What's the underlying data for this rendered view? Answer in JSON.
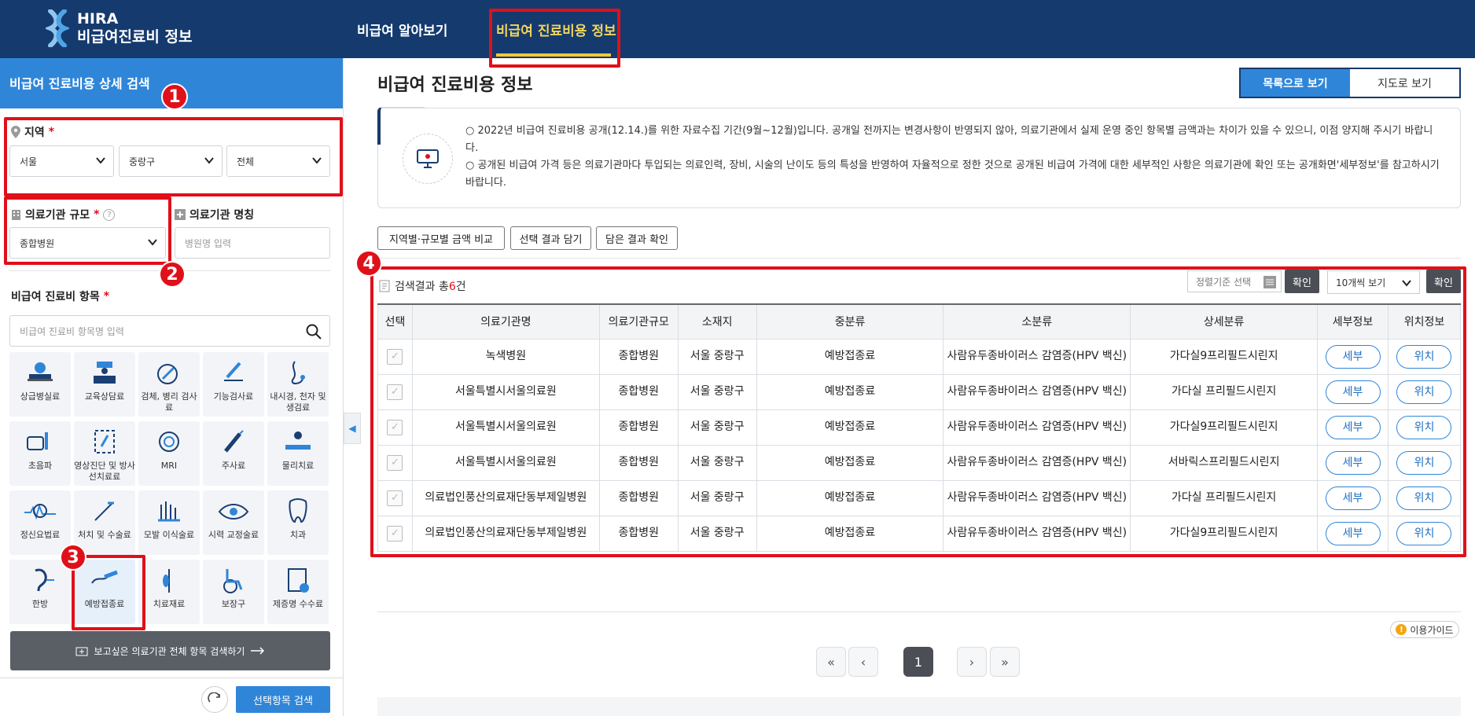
{
  "header": {
    "logo_line1": "HIRA",
    "logo_line2": "비급여진료비 정보",
    "nav": [
      "비급여 알아보기",
      "비급여 진료비용 정보"
    ]
  },
  "sidebar": {
    "title": "비급여 진료비용 상세 검색",
    "region_label": "지역",
    "region_values": [
      "서울",
      "중랑구",
      "전체"
    ],
    "scale_label": "의료기관 규모",
    "scale_value": "종합병원",
    "name_label": "의료기관 명칭",
    "name_placeholder": "병원명 입력",
    "items_label": "비급여 진료비 항목",
    "items_placeholder": "비급여 진료비 항목명 입력",
    "categories": [
      {
        "label": "상급병실료",
        "icon": "hospital-bed-icon"
      },
      {
        "label": "교육상담료",
        "icon": "consultation-icon"
      },
      {
        "label": "검체, 병리 검사료",
        "icon": "lab-test-icon"
      },
      {
        "label": "기능검사료",
        "icon": "function-test-icon"
      },
      {
        "label": "내시경, 천자 및 생검료",
        "icon": "endoscopy-icon"
      },
      {
        "label": "초음파",
        "icon": "ultrasound-icon"
      },
      {
        "label": "영상진단 및 방사선치료료",
        "icon": "imaging-icon"
      },
      {
        "label": "MRI",
        "icon": "mri-icon"
      },
      {
        "label": "주사료",
        "icon": "injection-icon"
      },
      {
        "label": "물리치료",
        "icon": "physical-therapy-icon"
      },
      {
        "label": "정신요법료",
        "icon": "brain-wave-icon"
      },
      {
        "label": "처치 및 수술료",
        "icon": "surgery-icon"
      },
      {
        "label": "모발 이식술료",
        "icon": "hair-transplant-icon"
      },
      {
        "label": "시력 교정술료",
        "icon": "eye-icon"
      },
      {
        "label": "치과",
        "icon": "tooth-icon"
      },
      {
        "label": "한방",
        "icon": "acupuncture-ear-icon"
      },
      {
        "label": "예방접종료",
        "icon": "vaccination-icon"
      },
      {
        "label": "치료재료",
        "icon": "medical-material-icon"
      },
      {
        "label": "보장구",
        "icon": "wheelchair-icon"
      },
      {
        "label": "제증명 수수료",
        "icon": "certificate-icon"
      }
    ],
    "all_items_button": "보고싶은 의료기관 전체 항목 검색하기",
    "search_button": "선택항목 검색"
  },
  "main": {
    "title": "비급여 진료비용 정보",
    "view_list": "목록으로 보기",
    "view_map": "지도로 보기",
    "notice1": "○ 2022년 비급여 진료비용 공개(12.14.)를 위한 자료수집 기간(9월~12월)입니다. 공개일 전까지는 변경사항이 반영되지 않아, 의료기관에서 실제 운영 중인 항목별 금액과는 차이가 있을 수 있으니, 이점 양지해 주시기 바랍니다.",
    "notice2": "○ 공개된 비급여 가격 등은 의료기관마다 투입되는 의료인력, 장비, 시술의 난이도 등의 특성을 반영하여 자율적으로 정한 것으로 공개된 비급여 가격에 대한 세부적인 사항은 의료기관에 확인 또는 공개화면'세부정보'를 참고하시기 바랍니다.",
    "actions": [
      "지역별·규모별 금액 비교",
      "선택 결과 담기",
      "담은 결과 확인"
    ],
    "result_prefix": "검색결과 총",
    "result_count": "6",
    "result_suffix": "건",
    "sort_label": "정렬기준 선택",
    "confirm": "확인",
    "per_page": "10개씩 보기",
    "columns": [
      "선택",
      "의료기관명",
      "의료기관규모",
      "소재지",
      "중분류",
      "소분류",
      "상세분류",
      "세부정보",
      "위치정보"
    ],
    "rows": [
      {
        "name": "녹색병원",
        "scale": "종합병원",
        "loc": "서울 중랑구",
        "mid": "예방접종료",
        "small": "사람유두종바이러스 감염증(HPV 백신)",
        "detail": "가다실9프리필드시린지"
      },
      {
        "name": "서울특별시서울의료원",
        "scale": "종합병원",
        "loc": "서울 중랑구",
        "mid": "예방접종료",
        "small": "사람유두종바이러스 감염증(HPV 백신)",
        "detail": "가다실 프리필드시린지"
      },
      {
        "name": "서울특별시서울의료원",
        "scale": "종합병원",
        "loc": "서울 중랑구",
        "mid": "예방접종료",
        "small": "사람유두종바이러스 감염증(HPV 백신)",
        "detail": "가다실9프리필드시린지"
      },
      {
        "name": "서울특별시서울의료원",
        "scale": "종합병원",
        "loc": "서울 중랑구",
        "mid": "예방접종료",
        "small": "사람유두종바이러스 감염증(HPV 백신)",
        "detail": "서바릭스프리필드시린지"
      },
      {
        "name": "의료법인풍산의료재단동부제일병원",
        "scale": "종합병원",
        "loc": "서울 중랑구",
        "mid": "예방접종료",
        "small": "사람유두종바이러스 감염증(HPV 백신)",
        "detail": "가다실 프리필드시린지"
      },
      {
        "name": "의료법인풍산의료재단동부제일병원",
        "scale": "종합병원",
        "loc": "서울 중랑구",
        "mid": "예방접종료",
        "small": "사람유두종바이러스 감염증(HPV 백신)",
        "detail": "가다실9프리필드시린지"
      }
    ],
    "detail_btn": "세부",
    "location_btn": "위치",
    "guide": "이용가이드",
    "page_current": "1"
  },
  "annotations": [
    "1",
    "2",
    "3",
    "4"
  ]
}
